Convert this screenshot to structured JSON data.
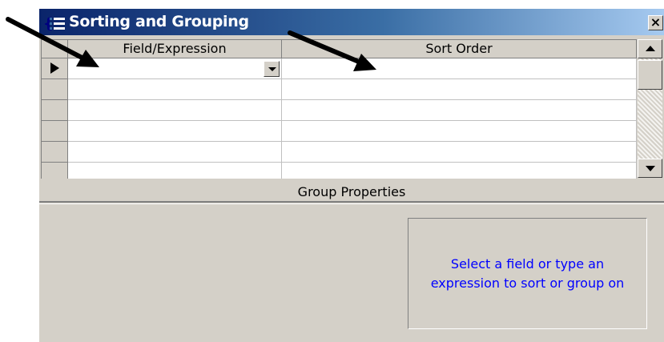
{
  "window": {
    "title": "Sorting and Grouping",
    "close_label": "×"
  },
  "grid": {
    "columns": [
      "Field/Expression",
      "Sort Order"
    ],
    "rows": [
      {
        "field": "",
        "sort_order": ""
      },
      {
        "field": "",
        "sort_order": ""
      },
      {
        "field": "",
        "sort_order": ""
      },
      {
        "field": "",
        "sort_order": ""
      },
      {
        "field": "",
        "sort_order": ""
      }
    ]
  },
  "group_properties": {
    "label": "Group Properties",
    "hint_line1": "Select a field or type an",
    "hint_line2": "expression to sort or group on"
  },
  "icons": [
    "report-grouping-icon",
    "close-icon",
    "dropdown-arrow-icon",
    "record-selector-arrow-icon",
    "scroll-up-icon",
    "scroll-down-icon",
    "annotation-arrow-icon"
  ],
  "colors": {
    "titlebar_start": "#0a246a",
    "titlebar_end": "#a6caf0",
    "dialog_bg": "#d4d0c8",
    "hint_text": "#0000ff"
  }
}
